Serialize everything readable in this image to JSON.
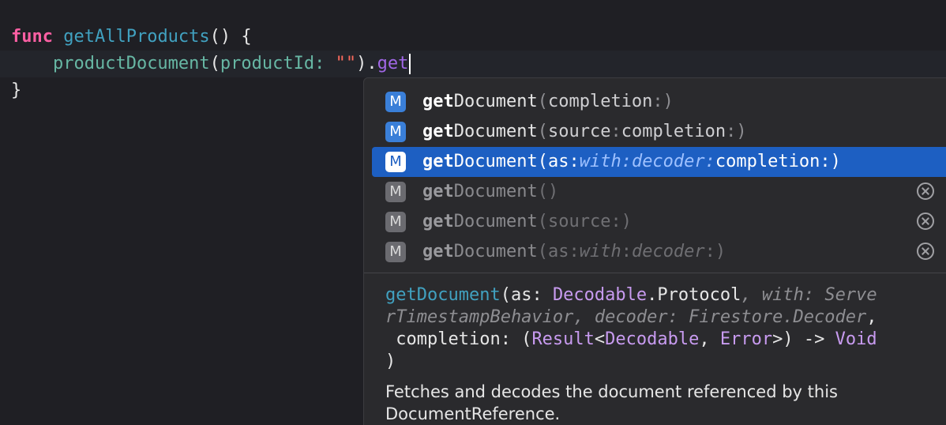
{
  "editor": {
    "line1": {
      "keyword": "func",
      "name": "getAllProducts",
      "tail": "() {"
    },
    "line2": {
      "indent": "    ",
      "call": "productDocument",
      "open": "(",
      "param": "productId:",
      "space": " ",
      "string": "\"\"",
      "close": ").",
      "typed": "get"
    },
    "line3": {
      "brace": "}"
    }
  },
  "autocomplete": {
    "badge_letter": "M",
    "items": [
      {
        "match": "get",
        "rest": "Document",
        "sig_open": "(",
        "sig_a": "completion",
        "sig_b": ":",
        "sig_c": ")",
        "sig_d": "",
        "sig_e": "",
        "sig_f": "",
        "selected": false,
        "deprecated": false
      },
      {
        "match": "get",
        "rest": "Document",
        "sig_open": "(",
        "sig_a": "source",
        "sig_b": ":",
        "sig_c": "completion",
        "sig_d": ":",
        "sig_e": ")",
        "sig_f": "",
        "selected": false,
        "deprecated": false
      },
      {
        "match": "get",
        "rest": "Document",
        "sig_open": "(",
        "sig_a": "as:",
        "sig_b": "with:decoder:",
        "sig_c": "completion:)",
        "sig_d": "",
        "sig_e": "",
        "sig_f": "",
        "selected": true,
        "deprecated": false
      },
      {
        "match": "get",
        "rest": "Document",
        "sig_open": "(",
        "sig_a": ")",
        "sig_b": "",
        "sig_c": "",
        "sig_d": "",
        "sig_e": "",
        "sig_f": "",
        "selected": false,
        "deprecated": true
      },
      {
        "match": "get",
        "rest": "Document",
        "sig_open": "(",
        "sig_a": "source",
        "sig_b": ":",
        "sig_c": ")",
        "sig_d": "",
        "sig_e": "",
        "sig_f": "",
        "selected": false,
        "deprecated": true
      },
      {
        "match": "get",
        "rest": "Document",
        "sig_open": "(",
        "sig_a": "as",
        "sig_b": ":",
        "sig_c": "with",
        "sig_d": ":",
        "sig_e": "decoder",
        "sig_f": ":)",
        "selected": false,
        "deprecated": true
      }
    ]
  },
  "documentation": {
    "sig_line1": {
      "fn": "getDocument",
      "p1": "(as: ",
      "t1": "Decodable",
      "p2": ".Protocol",
      "i1": ", with: Serve"
    },
    "sig_line2": {
      "i2": "rTimestampBehavior, decoder: Firestore.Decoder",
      "p3": ","
    },
    "sig_line3": {
      "p4": " completion: (",
      "t2": "Result",
      "p5": "<",
      "t3": "Decodable",
      "p6": ", ",
      "t4": "Error",
      "p7": ">) -> ",
      "t5": "Void"
    },
    "sig_line4": {
      "p8": ")"
    },
    "description": "Fetches and decodes the document referenced by this DocumentReference."
  }
}
